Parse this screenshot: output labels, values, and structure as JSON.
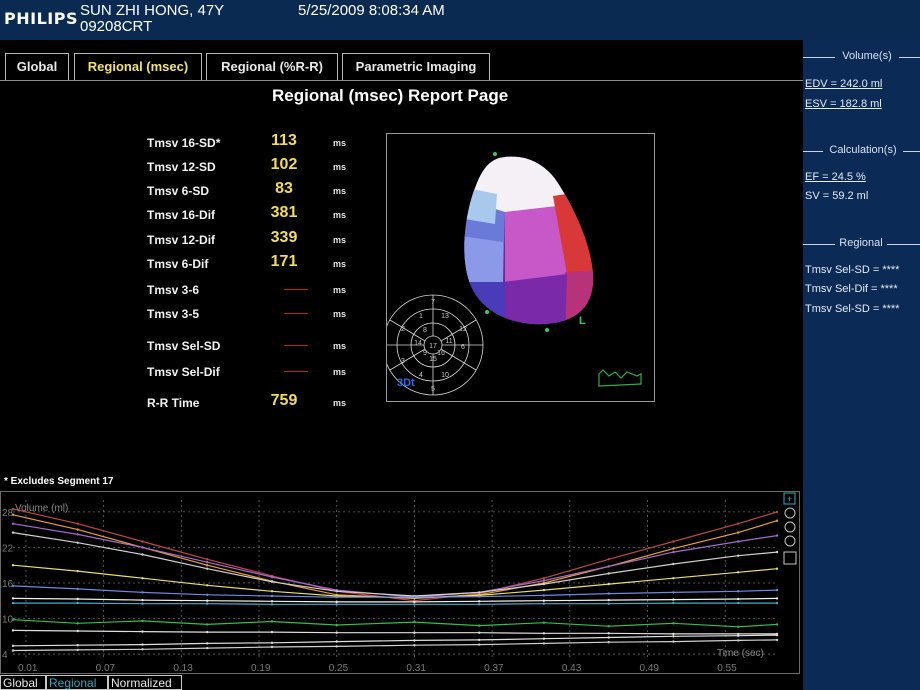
{
  "header": {
    "brand": "PHILIPS",
    "patient_name": "SUN ZHI HONG, 47Y",
    "patient_id": "09208CRT",
    "datetime": "5/25/2009  8:08:34 AM"
  },
  "tabs": [
    "Global",
    "Regional (msec)",
    "Regional (%R-R)",
    "Parametric Imaging"
  ],
  "active_tab": "Regional (msec)",
  "report_title": "Regional (msec) Report Page",
  "metrics": [
    {
      "label": "Tmsv 16-SD*",
      "value": "113",
      "unit": "ms"
    },
    {
      "label": "Tmsv 12-SD",
      "value": "102",
      "unit": "ms"
    },
    {
      "label": "Tmsv 6-SD",
      "value": "83",
      "unit": "ms"
    },
    {
      "label": "Tmsv 16-Dif",
      "value": "381",
      "unit": "ms"
    },
    {
      "label": "Tmsv 12-Dif",
      "value": "339",
      "unit": "ms"
    },
    {
      "label": "Tmsv 6-Dif",
      "value": "171",
      "unit": "ms"
    },
    {
      "label": "Tmsv 3-6",
      "value": "",
      "unit": "ms"
    },
    {
      "label": "Tmsv 3-5",
      "value": "",
      "unit": "ms"
    },
    {
      "label": "Tmsv Sel-SD",
      "value": "",
      "unit": "ms"
    },
    {
      "label": "Tmsv Sel-Dif",
      "value": "",
      "unit": "ms"
    },
    {
      "label": "R-R Time",
      "value": "759",
      "unit": "ms"
    }
  ],
  "view3d": {
    "label_3d": "3Dt",
    "label_l": "L",
    "bullseye_numbers": [
      "7",
      "1",
      "8",
      "13",
      "2",
      "14",
      "3",
      "15",
      "4",
      "9",
      "16",
      "10",
      "12",
      "6",
      "11",
      "5",
      "17"
    ]
  },
  "excludes_note": "* Excludes Segment 17",
  "right_panel": {
    "volume": {
      "title": "Volume(s)",
      "edv": "EDV = 242.0 ml",
      "esv": "ESV = 182.8 ml"
    },
    "calculation": {
      "title": "Calculation(s)",
      "ef": "EF = 24.5 %",
      "sv": "SV = 59.2 ml"
    },
    "regional": {
      "title": "Regional",
      "items": [
        "Tmsv Sel-SD = ****",
        "Tmsv Sel-Dif = ****",
        "Tmsv Sel-SD = ****"
      ]
    }
  },
  "chart_data": {
    "type": "line",
    "ylabel": "Volume (ml)",
    "xlabel": "Time (sec)",
    "x_ticks": [
      "0.01",
      "0.07",
      "0.13",
      "0.19",
      "0.25",
      "0.31",
      "0.37",
      "0.43",
      "0.49",
      "0.55"
    ],
    "y_ticks": [
      "4",
      "10",
      "16",
      "22",
      "28"
    ],
    "xlim": [
      0.0,
      0.59
    ],
    "ylim": [
      3,
      30
    ],
    "x": [
      0.0,
      0.05,
      0.1,
      0.15,
      0.2,
      0.25,
      0.31,
      0.36,
      0.41,
      0.46,
      0.51,
      0.56,
      0.59
    ],
    "series": [
      {
        "color": "#c04848",
        "values": [
          28.5,
          26.0,
          23.0,
          20.0,
          17.2,
          14.6,
          13.0,
          14.2,
          16.8,
          20.0,
          23.0,
          26.0,
          28.0
        ]
      },
      {
        "color": "#e8a030",
        "values": [
          27.5,
          25.0,
          22.0,
          19.0,
          16.3,
          14.0,
          13.4,
          14.0,
          16.0,
          18.8,
          21.8,
          24.5,
          26.5
        ]
      },
      {
        "color": "#a868d0",
        "values": [
          26.0,
          24.2,
          22.0,
          19.5,
          17.0,
          14.8,
          13.6,
          14.4,
          16.4,
          18.8,
          21.2,
          23.0,
          24.0
        ]
      },
      {
        "color": "#d0d0d0",
        "values": [
          24.5,
          22.8,
          20.8,
          18.4,
          16.2,
          14.6,
          13.8,
          14.4,
          15.8,
          17.6,
          19.2,
          20.6,
          21.2
        ]
      },
      {
        "color": "#e8e060",
        "values": [
          19.0,
          18.0,
          16.8,
          15.6,
          14.6,
          13.8,
          13.5,
          13.9,
          14.8,
          15.8,
          16.8,
          17.8,
          18.4
        ]
      },
      {
        "color": "#6a8ae8",
        "values": [
          15.5,
          15.0,
          14.4,
          14.0,
          13.8,
          13.6,
          13.6,
          13.7,
          13.9,
          14.2,
          14.4,
          14.6,
          14.8
        ]
      },
      {
        "color": "#f0f0f0",
        "values": [
          13.4,
          13.3,
          13.1,
          13.0,
          12.9,
          12.8,
          12.8,
          12.9,
          13.0,
          13.1,
          13.2,
          13.3,
          13.4
        ]
      },
      {
        "color": "#40b0c8",
        "values": [
          12.6,
          12.6,
          12.5,
          12.5,
          12.4,
          12.4,
          12.4,
          12.4,
          12.5,
          12.5,
          12.6,
          12.6,
          12.6
        ]
      },
      {
        "color": "#30c050",
        "values": [
          9.8,
          9.2,
          9.6,
          9.0,
          9.5,
          8.9,
          9.4,
          8.8,
          9.3,
          8.7,
          9.2,
          8.6,
          9.0
        ]
      },
      {
        "color": "#e0e0e0",
        "values": [
          8.0,
          7.9,
          7.8,
          7.7,
          7.7,
          7.6,
          7.6,
          7.6,
          7.5,
          7.5,
          7.4,
          7.4,
          7.4
        ]
      },
      {
        "color": "#e0e0e0",
        "values": [
          5.4,
          5.5,
          5.6,
          5.8,
          5.9,
          6.1,
          6.3,
          6.4,
          6.6,
          6.8,
          7.0,
          7.1,
          7.2
        ]
      },
      {
        "color": "#d0d0d0",
        "values": [
          4.6,
          4.7,
          4.8,
          5.0,
          5.2,
          5.3,
          5.5,
          5.6,
          5.8,
          6.0,
          6.1,
          6.3,
          6.4
        ]
      }
    ],
    "grid": true
  },
  "bottom_tabs": [
    "Global",
    "Regional",
    "Normalized"
  ],
  "bottom_active": "Regional"
}
